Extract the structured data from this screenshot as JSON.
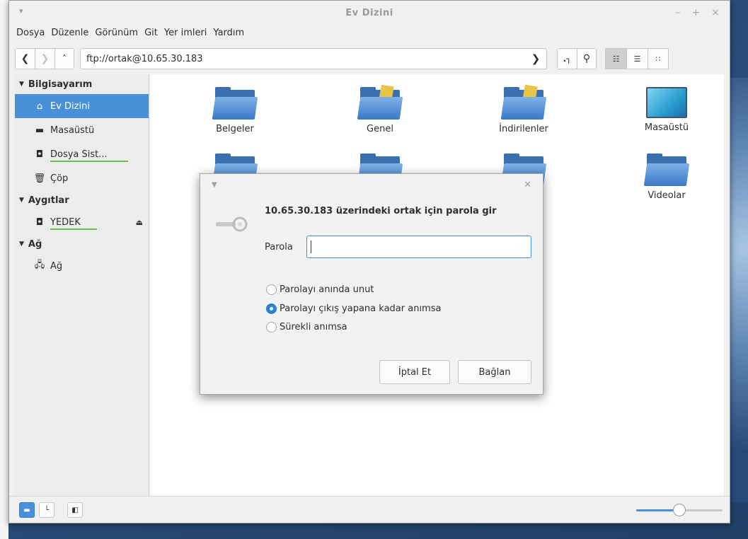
{
  "window": {
    "title": "Ev Dizini",
    "controls": [
      "–",
      "+",
      "×"
    ],
    "menu_arrow": "▾"
  },
  "menubar": [
    "Dosya",
    "Düzenle",
    "Görünüm",
    "Git",
    "Yer imleri",
    "Yardım"
  ],
  "toolbar": {
    "address": "ftp://ortak@10.65.30.183"
  },
  "sidebar": {
    "sections": [
      {
        "title": "Bilgisayarım",
        "items": [
          {
            "label": "Ev Dizini",
            "icon": "home-icon",
            "active": true
          },
          {
            "label": "Masaüstü",
            "icon": "folder-icon"
          },
          {
            "label": "Dosya Sist...",
            "icon": "drive-icon"
          },
          {
            "label": "Çöp",
            "icon": "trash-icon"
          }
        ]
      },
      {
        "title": "Aygıtlar",
        "items": [
          {
            "label": "YEDEK",
            "icon": "drive-icon",
            "eject": true
          }
        ]
      },
      {
        "title": "Ağ",
        "items": [
          {
            "label": "Ağ",
            "icon": "network-icon"
          }
        ]
      }
    ]
  },
  "files": [
    {
      "label": "Belgeler"
    },
    {
      "label": "Genel"
    },
    {
      "label": "İndirilenler"
    },
    {
      "label": "Masaüstü"
    },
    {
      "label": "Videolar"
    }
  ],
  "dialog": {
    "title": "10.65.30.183 üzerindeki ortak için parola gir",
    "password_label": "Parola",
    "password_value": "",
    "options": [
      {
        "label": "Parolayı anında unut",
        "checked": false
      },
      {
        "label": "Parolayı çıkış yapana kadar anımsa",
        "checked": true
      },
      {
        "label": "Sürekli anımsa",
        "checked": false
      }
    ],
    "cancel_label": "İptal Et",
    "connect_label": "Bağlan"
  },
  "statusbar": {
    "zoom_level": 0.5
  },
  "colors": {
    "accent": "#4a90d9",
    "folder": "#3a78c8"
  }
}
